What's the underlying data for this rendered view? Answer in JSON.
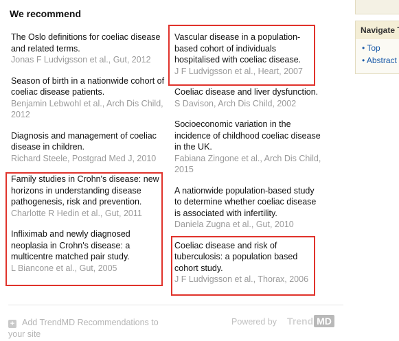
{
  "heading": "We recommend",
  "left_items": [
    {
      "title": "The Oslo definitions for coeliac disease and related terms.",
      "meta": "Jonas F Ludvigsson et al., Gut, 2012"
    },
    {
      "title": "Season of birth in a nationwide cohort of coeliac disease patients.",
      "meta": "Benjamin Lebwohl et al., Arch Dis Child, 2012"
    },
    {
      "title": "Diagnosis and management of coeliac disease in children.",
      "meta": "Richard Steele, Postgrad Med J, 2010"
    },
    {
      "title": "Family studies in Crohn's disease: new horizons in understanding disease pathogenesis, risk and prevention.",
      "meta": "Charlotte R Hedin et al., Gut, 2011"
    },
    {
      "title": "Infliximab and newly diagnosed neoplasia in Crohn's disease: a multicentre matched pair study.",
      "meta": "L Biancone et al., Gut, 2005"
    }
  ],
  "right_items": [
    {
      "title": "Vascular disease in a population-based cohort of individuals hospitalised with coeliac disease.",
      "meta": "J F Ludvigsson et al., Heart, 2007"
    },
    {
      "title": "Coeliac disease and liver dysfunction.",
      "meta": "S Davison, Arch Dis Child, 2002"
    },
    {
      "title": "Socioeconomic variation in the incidence of childhood coeliac disease in the UK.",
      "meta": "Fabiana Zingone et al., Arch Dis Child, 2015"
    },
    {
      "title": "A nationwide population-based study to determine whether coeliac disease is associated with infertility.",
      "meta": "Daniela Zugna et al., Gut, 2010"
    },
    {
      "title": "Coeliac disease and risk of tuberculosis: a population based cohort study.",
      "meta": "J F Ludvigsson et al., Thorax, 2006"
    }
  ],
  "footer": {
    "add_label": "Add TrendMD Recommendations to your site",
    "add_icon": "plus-icon",
    "powered_by": "Powered by",
    "logo_trend": "Trend",
    "logo_md": "MD"
  },
  "sidebar": {
    "nav_title": "Navigate This Article",
    "links": [
      "• Top",
      "• Abstract"
    ]
  },
  "colors": {
    "highlight_box": "#e0322b",
    "link": "#1a5aa8",
    "meta": "#9a9a9a"
  }
}
